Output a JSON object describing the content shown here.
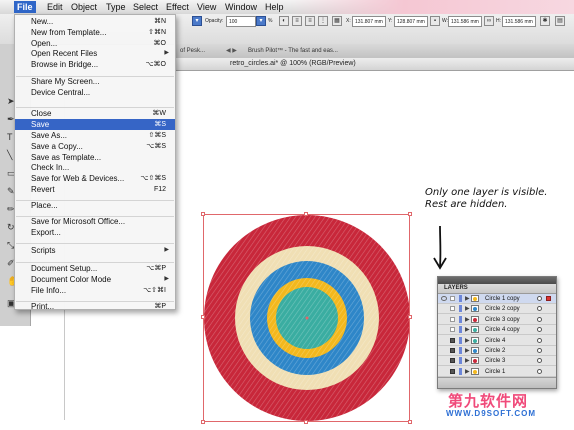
{
  "menubar": {
    "items": [
      "File",
      "Edit",
      "Object",
      "Type",
      "Select",
      "Effect",
      "View",
      "Window",
      "Help"
    ],
    "active": "File"
  },
  "controlbar": {
    "opacity_label": "Opacity:",
    "opacity_value": "100",
    "percent": "%",
    "x_label": "X:",
    "x_value": "131.807 mm",
    "y_label": "Y:",
    "y_value": "128.807 mm",
    "w_label": "W:",
    "w_value": "131.586 mm",
    "h_label": "H:",
    "h_value": "131.586 mm"
  },
  "tabs": {
    "tab1": "of Pesk...",
    "tab2": "Brush Pilot™ - The fast and eas..."
  },
  "document": {
    "title": "retro_circles.ai* @ 100% (RGB/Preview)"
  },
  "file_menu": {
    "items": [
      {
        "label": "New...",
        "shortcut": "⌘N"
      },
      {
        "label": "New from Template...",
        "shortcut": "⇧⌘N"
      },
      {
        "label": "Open...",
        "shortcut": "⌘O"
      },
      {
        "label": "Open Recent Files",
        "shortcut": "▶"
      },
      {
        "label": "Browse in Bridge...",
        "shortcut": "⌥⌘O"
      },
      {
        "label": "Share My Screen...",
        "shortcut": ""
      },
      {
        "label": "Device Central...",
        "shortcut": ""
      },
      {
        "label": "Close",
        "shortcut": "⌘W"
      },
      {
        "label": "Save",
        "shortcut": "⌘S"
      },
      {
        "label": "Save As...",
        "shortcut": "⇧⌘S"
      },
      {
        "label": "Save a Copy...",
        "shortcut": "⌥⌘S"
      },
      {
        "label": "Save as Template...",
        "shortcut": ""
      },
      {
        "label": "Check In...",
        "shortcut": ""
      },
      {
        "label": "Save for Web & Devices...",
        "shortcut": "⌥⇧⌘S"
      },
      {
        "label": "Revert",
        "shortcut": "F12"
      },
      {
        "label": "Place...",
        "shortcut": ""
      },
      {
        "label": "Save for Microsoft Office...",
        "shortcut": ""
      },
      {
        "label": "Export...",
        "shortcut": ""
      },
      {
        "label": "Scripts",
        "shortcut": "▶"
      },
      {
        "label": "Document Setup...",
        "shortcut": "⌥⌘P"
      },
      {
        "label": "Document Color Mode",
        "shortcut": "▶"
      },
      {
        "label": "File Info...",
        "shortcut": "⌥⇧⌘I"
      },
      {
        "label": "Print...",
        "shortcut": "⌘P"
      }
    ],
    "selected": "Save"
  },
  "annotation": {
    "line1": "Only one layer is visible.",
    "line2": "Rest are hidden."
  },
  "layers_panel": {
    "title": "LAYERS",
    "rows": [
      {
        "name": "Circle 1 copy",
        "visible": true,
        "locked": false
      },
      {
        "name": "Circle 2 copy",
        "visible": false,
        "locked": false
      },
      {
        "name": "Circle 3 copy",
        "visible": false,
        "locked": false
      },
      {
        "name": "Circle 4 copy",
        "visible": false,
        "locked": false
      },
      {
        "name": "Circle 4",
        "visible": false,
        "locked": true
      },
      {
        "name": "Circle 2",
        "visible": false,
        "locked": true
      },
      {
        "name": "Circle 3",
        "visible": false,
        "locked": true
      },
      {
        "name": "Circle 1",
        "visible": false,
        "locked": true
      }
    ]
  },
  "artwork": {
    "colors": {
      "outer_ring": "#c8273a",
      "cream_ring": "#f0dfb4",
      "blue_ring": "#2e86c8",
      "yellow_ring": "#f3b81d",
      "center": "#3aada1"
    }
  },
  "watermark": {
    "main": "第九软件网",
    "sub": "WWW.D9SOFT.COM"
  }
}
